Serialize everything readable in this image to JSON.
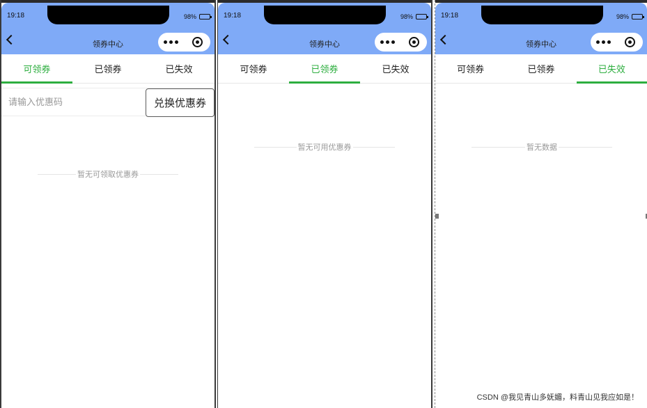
{
  "colors": {
    "header_bg": "#7faaf7",
    "accent_green": "#2dae3f",
    "muted_text": "#999999"
  },
  "screens": [
    {
      "status": {
        "time": "19:18",
        "battery": "98%",
        "battery_level": 0.98
      },
      "nav": {
        "title": "领券中心",
        "back_icon": "chevron-left-icon",
        "more_icon": "more-dots-icon",
        "close_icon": "close-circle-icon"
      },
      "tabs": [
        {
          "label": "可领券",
          "active": true
        },
        {
          "label": "已领券",
          "active": false
        },
        {
          "label": "已失效",
          "active": false
        }
      ],
      "redeem": {
        "placeholder": "请输入优惠码",
        "button_label": "兑换优惠券"
      },
      "empty_text": "暂无可领取优惠券"
    },
    {
      "status": {
        "time": "19:18",
        "battery": "98%",
        "battery_level": 0.98
      },
      "nav": {
        "title": "领券中心",
        "back_icon": "chevron-left-icon",
        "more_icon": "more-dots-icon",
        "close_icon": "close-circle-icon"
      },
      "tabs": [
        {
          "label": "可领券",
          "active": false
        },
        {
          "label": "已领券",
          "active": true
        },
        {
          "label": "已失效",
          "active": false
        }
      ],
      "empty_text": "暂无可用优惠券"
    },
    {
      "status": {
        "time": "19:18",
        "battery": "98%",
        "battery_level": 0.98
      },
      "nav": {
        "title": "领券中心",
        "back_icon": "chevron-left-icon",
        "more_icon": "more-dots-icon",
        "close_icon": "close-circle-icon"
      },
      "tabs": [
        {
          "label": "可领券",
          "active": false
        },
        {
          "label": "已领券",
          "active": false
        },
        {
          "label": "已失效",
          "active": true
        }
      ],
      "empty_text": "暂无数据"
    }
  ],
  "watermark": "CSDN @我见青山多妩媚，料青山见我应如是！"
}
